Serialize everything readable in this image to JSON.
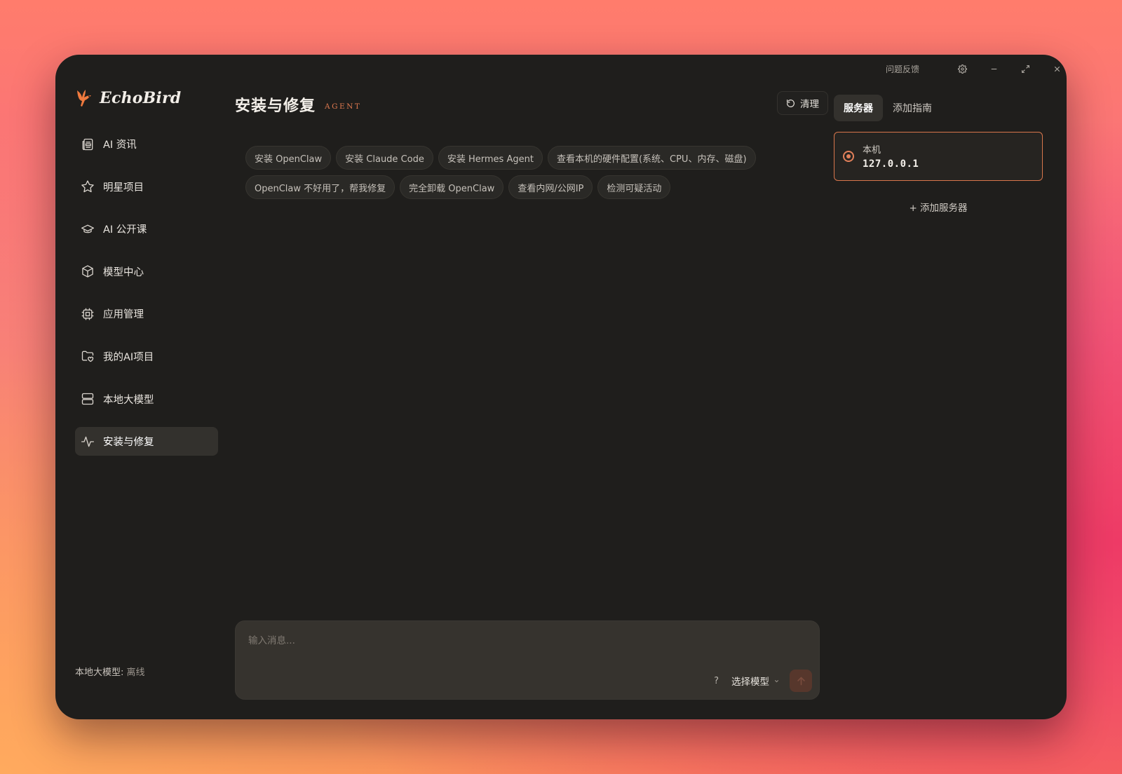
{
  "titlebar": {
    "feedback_label": "问题反馈"
  },
  "brand": {
    "name": "EchoBird",
    "accent": "#f07a3e"
  },
  "sidebar": {
    "items": [
      {
        "label": "AI 资讯",
        "icon": "newspaper-icon"
      },
      {
        "label": "明星项目",
        "icon": "star-icon"
      },
      {
        "label": "AI 公开课",
        "icon": "graduation-cap-icon"
      },
      {
        "label": "模型中心",
        "icon": "cube-icon"
      },
      {
        "label": "应用管理",
        "icon": "cpu-chip-icon"
      },
      {
        "label": "我的AI项目",
        "icon": "folder-heart-icon"
      },
      {
        "label": "本地大模型",
        "icon": "server-icon"
      },
      {
        "label": "安装与修复",
        "icon": "activity-icon",
        "active": true
      }
    ],
    "status_label": "本地大模型: ",
    "status_value": "离线"
  },
  "main": {
    "title": "安装与修复",
    "badge": "AGENT",
    "clear_label": "清理",
    "suggestions": [
      "安装 OpenClaw",
      "安装 Claude Code",
      "安装 Hermes Agent",
      "查看本机的硬件配置(系统、CPU、内存、磁盘)",
      "OpenClaw 不好用了，帮我修复",
      "完全卸载 OpenClaw",
      "查看内网/公网IP",
      "检测可疑活动"
    ],
    "composer": {
      "placeholder": "输入消息...",
      "help_label": "?",
      "model_label": "选择模型"
    }
  },
  "right_panel": {
    "tabs": [
      "服务器",
      "添加指南"
    ],
    "server": {
      "name": "本机",
      "ip": "127.0.0.1"
    },
    "add_server_label": "+ 添加服务器"
  },
  "colors": {
    "window_bg": "#1f1e1c",
    "accent": "#e2805a",
    "active_bg": "#33312d"
  }
}
